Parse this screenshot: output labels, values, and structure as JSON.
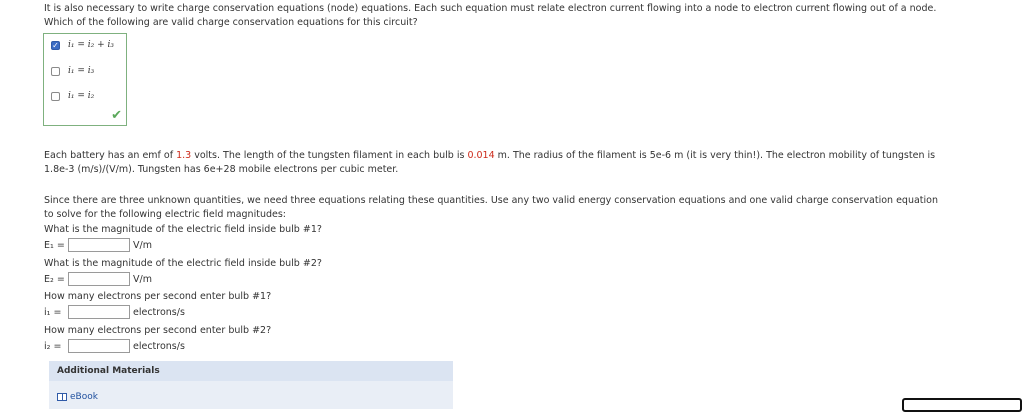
{
  "intro": {
    "line1": "It is also necessary to write charge conservation equations (node) equations. Each such equation must relate electron current flowing into a node to electron current flowing out of a node.",
    "line2": "Which of the following are valid charge conservation equations for this circuit?"
  },
  "options": [
    {
      "label": "i₁ = i₂ + i₃",
      "checked": true
    },
    {
      "label": "i₁ = i₃",
      "checked": false
    },
    {
      "label": "i₁ = i₂",
      "checked": false
    }
  ],
  "problem": {
    "p1_a": "Each battery has an emf of ",
    "emf": "1.3",
    "p1_b": " volts. The length of the tungsten filament in each bulb is ",
    "length": "0.014",
    "p1_c": " m. The radius of the filament is 5e-6 m (it is very thin!). The electron mobility of tungsten is",
    "p2": "1.8e-3 (m/s)/(V/m). Tungsten has 6e+28 mobile electrons per cubic meter."
  },
  "instructions": {
    "line1": "Since there are three unknown quantities, we need three equations relating these quantities. Use any two valid energy conservation equations and one valid charge conservation equation",
    "line2": "to solve for the following electric field magnitudes:"
  },
  "questions": [
    {
      "prompt": "What is the magnitude of the electric field inside bulb #1?",
      "var": "E₁ =",
      "value": "",
      "unit": "V/m"
    },
    {
      "prompt": "What is the magnitude of the electric field inside bulb #2?",
      "var": "E₂ =",
      "value": "",
      "unit": "V/m"
    },
    {
      "prompt": "How many electrons per second enter bulb #1?",
      "var": "i₁ =",
      "value": "",
      "unit": "electrons/s"
    },
    {
      "prompt": "How many electrons per second enter bulb #2?",
      "var": "i₂ =",
      "value": "",
      "unit": "electrons/s"
    }
  ],
  "materials": {
    "header": "Additional Materials",
    "ebook": "eBook"
  },
  "colors": {
    "highlight": "#cc2a1a",
    "correct": "#5aa85a",
    "checkbox": "#3b6cc4",
    "panel": "#e9eef6"
  }
}
